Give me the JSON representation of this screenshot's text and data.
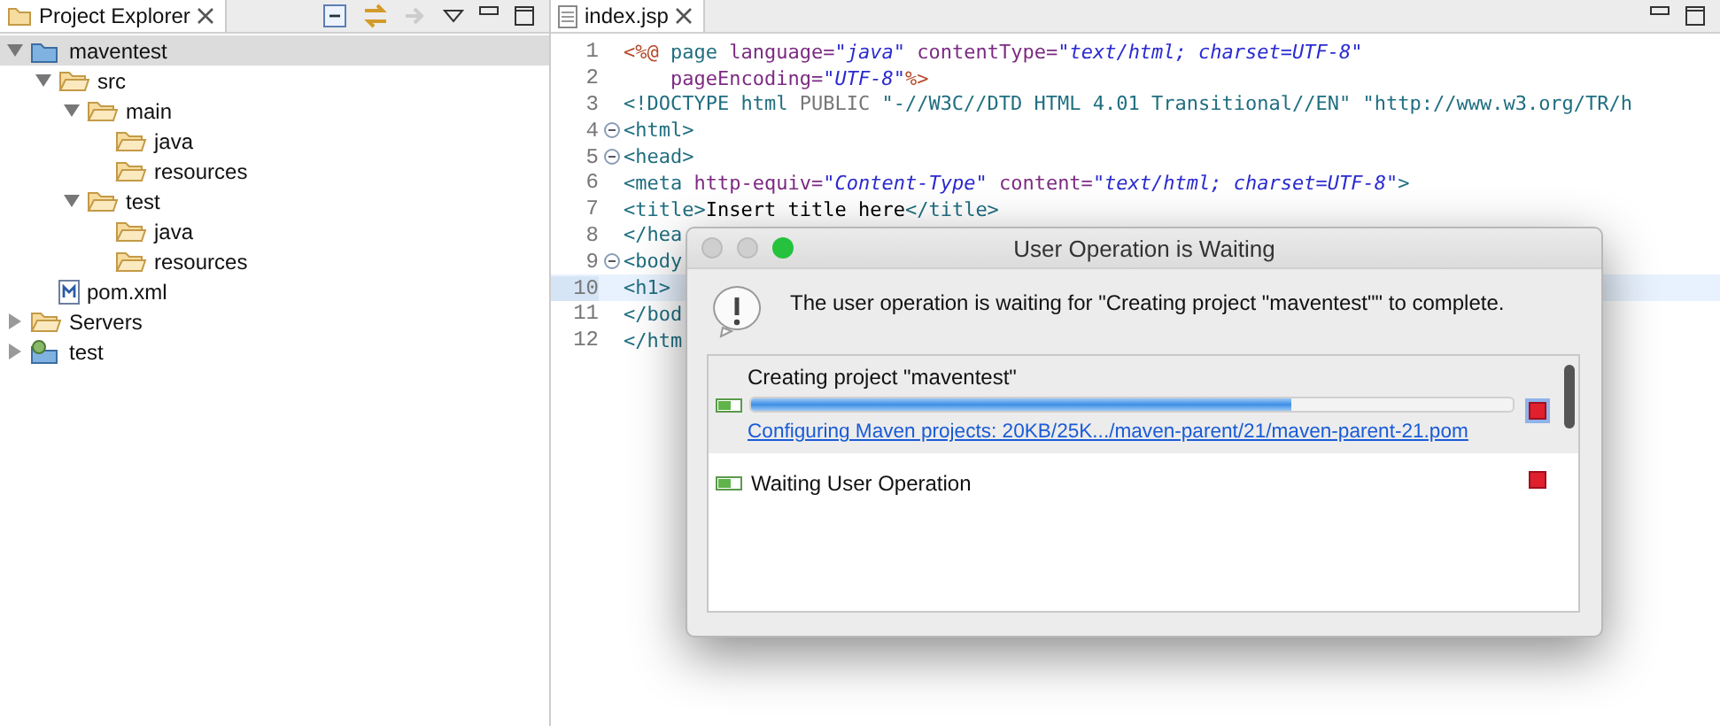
{
  "explorer": {
    "tab": {
      "label": "Project Explorer",
      "selected": true
    },
    "tree": [
      {
        "label": "maventest",
        "kind": "project",
        "expanded": true,
        "selected": true,
        "children": [
          {
            "label": "src",
            "kind": "folder",
            "expanded": true,
            "selected": false,
            "children": [
              {
                "label": "main",
                "kind": "folder",
                "expanded": true,
                "selected": false,
                "children": [
                  {
                    "label": "java",
                    "kind": "folder",
                    "selected": false
                  },
                  {
                    "label": "resources",
                    "kind": "folder",
                    "selected": false
                  }
                ]
              },
              {
                "label": "test",
                "kind": "folder",
                "expanded": true,
                "selected": false,
                "children": [
                  {
                    "label": "java",
                    "kind": "folder",
                    "selected": false
                  },
                  {
                    "label": "resources",
                    "kind": "folder",
                    "selected": false
                  }
                ]
              }
            ]
          },
          {
            "label": "pom.xml",
            "kind": "file",
            "selected": false
          }
        ]
      },
      {
        "label": "Servers",
        "kind": "folder",
        "expanded": false,
        "selected": false
      },
      {
        "label": "test",
        "kind": "webproject",
        "expanded": false,
        "selected": false
      }
    ]
  },
  "editor": {
    "tab": {
      "label": "index.jsp",
      "selected": true
    },
    "lines": [
      {
        "number": "1",
        "fold": false,
        "current": false,
        "tokens": [
          {
            "text": "<%@",
            "kind": "jsp"
          },
          {
            "text": " page",
            "kind": "tag"
          },
          {
            "text": " language=",
            "kind": "attr"
          },
          {
            "text": "\"java\"",
            "kind": "value"
          },
          {
            "text": " contentType=",
            "kind": "attr"
          },
          {
            "text": "\"text/html; charset=UTF-8\"",
            "kind": "value"
          }
        ]
      },
      {
        "number": "2",
        "fold": false,
        "current": false,
        "tokens": [
          {
            "text": "    pageEncoding=",
            "kind": "attr"
          },
          {
            "text": "\"UTF-8\"",
            "kind": "value"
          },
          {
            "text": "%>",
            "kind": "jsp"
          }
        ]
      },
      {
        "number": "3",
        "fold": false,
        "current": false,
        "tokens": [
          {
            "text": "<!DOCTYPE html",
            "kind": "tag"
          },
          {
            "text": " PUBLIC",
            "kind": "keyword"
          },
          {
            "text": " \"-//W3C//DTD HTML 4.01 Transitional//EN\" \"http://www.w3.org/TR/h",
            "kind": "tag"
          }
        ]
      },
      {
        "number": "4",
        "fold": true,
        "current": false,
        "tokens": [
          {
            "text": "<html>",
            "kind": "tag"
          }
        ]
      },
      {
        "number": "5",
        "fold": true,
        "current": false,
        "tokens": [
          {
            "text": "<head>",
            "kind": "tag"
          }
        ]
      },
      {
        "number": "6",
        "fold": false,
        "current": false,
        "tokens": [
          {
            "text": "<meta",
            "kind": "tag"
          },
          {
            "text": " http-equiv=",
            "kind": "attr"
          },
          {
            "text": "\"Content-Type\"",
            "kind": "value"
          },
          {
            "text": " content=",
            "kind": "attr"
          },
          {
            "text": "\"text/html; charset=UTF-8\"",
            "kind": "value"
          },
          {
            "text": ">",
            "kind": "tag"
          }
        ]
      },
      {
        "number": "7",
        "fold": false,
        "current": false,
        "tokens": [
          {
            "text": "<title>",
            "kind": "tag"
          },
          {
            "text": "Insert title here",
            "kind": "text"
          },
          {
            "text": "</title>",
            "kind": "tag"
          }
        ]
      },
      {
        "number": "8",
        "fold": false,
        "current": false,
        "tokens": [
          {
            "text": "</hea",
            "kind": "tag"
          }
        ]
      },
      {
        "number": "9",
        "fold": true,
        "current": false,
        "tokens": [
          {
            "text": "<body",
            "kind": "tag"
          }
        ]
      },
      {
        "number": "10",
        "fold": false,
        "current": true,
        "tokens": [
          {
            "text": "<h1>",
            "kind": "tag"
          }
        ]
      },
      {
        "number": "11",
        "fold": false,
        "current": false,
        "tokens": [
          {
            "text": "</bod",
            "kind": "tag"
          }
        ]
      },
      {
        "number": "12",
        "fold": false,
        "current": false,
        "tokens": [
          {
            "text": "</htm",
            "kind": "tag"
          }
        ]
      }
    ]
  },
  "dialog": {
    "title": "User Operation is Waiting",
    "message": "The user operation is waiting for \"Creating project \"maventest\"\" to complete.",
    "jobs": [
      {
        "title": "Creating project \"maventest\"",
        "selected": true,
        "level": 0.71,
        "detail": "Configuring Maven projects: 20KB/25K.../maven-parent/21/maven-parent-21.pom"
      },
      {
        "title": "Waiting User Operation",
        "selected": false
      }
    ]
  }
}
